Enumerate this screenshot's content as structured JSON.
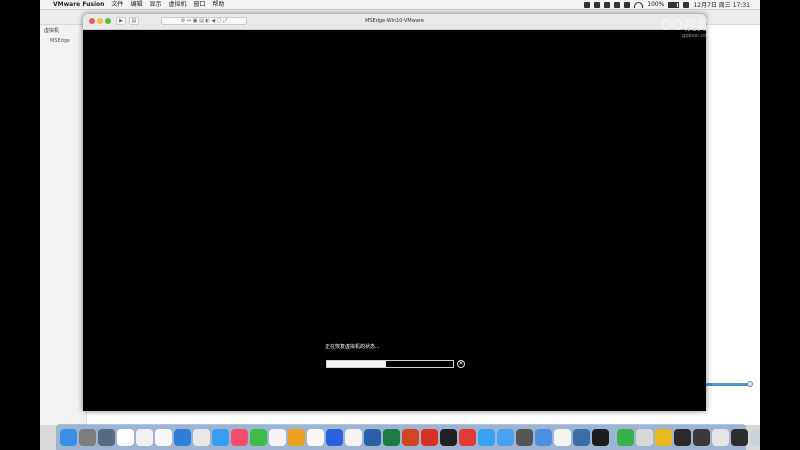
{
  "menubar": {
    "app_name": "VMware Fusion",
    "menus": [
      "文件",
      "编辑",
      "显示",
      "虚拟机",
      "窗口",
      "帮助"
    ],
    "battery_percent": "100%",
    "clock": "12月7日 周三 17:31"
  },
  "library": {
    "sidebar_header": "虚拟机",
    "sidebar_item": "MSEdge"
  },
  "vm_window": {
    "title": "MSEdge-Win10-VMware",
    "restore_message": "正在恢复虚拟机的状态...",
    "progress": 0.47,
    "cancel_symbol": "✕"
  },
  "dock": {
    "icons": [
      {
        "name": "finder-icon",
        "color": "#3d8ee6"
      },
      {
        "name": "system-preferences-icon",
        "color": "#7d7d7d"
      },
      {
        "name": "launchpad-icon",
        "color": "#5a6b80"
      },
      {
        "name": "calendar-icon",
        "color": "#ffffff"
      },
      {
        "name": "notes-icon",
        "color": "#f0f0f0"
      },
      {
        "name": "reminders-icon",
        "color": "#f7f7f7"
      },
      {
        "name": "safari-icon",
        "color": "#2f7fd8"
      },
      {
        "name": "chrome-icon",
        "color": "#e8e8e8"
      },
      {
        "name": "appstore-icon",
        "color": "#3a9cf0"
      },
      {
        "name": "music-icon",
        "color": "#f24e6b"
      },
      {
        "name": "wechat-icon",
        "color": "#3fbb4a"
      },
      {
        "name": "photos-icon",
        "color": "#f4f4f4"
      },
      {
        "name": "pages-icon",
        "color": "#f0a020"
      },
      {
        "name": "vpn-icon",
        "color": "#f8f8f8"
      },
      {
        "name": "baidu-icon",
        "color": "#2860e0"
      },
      {
        "name": "cloud-icon",
        "color": "#f3f3f3"
      },
      {
        "name": "word-icon",
        "color": "#2b5faa"
      },
      {
        "name": "excel-icon",
        "color": "#1f7a45"
      },
      {
        "name": "powerpoint-icon",
        "color": "#d04625"
      },
      {
        "name": "wps-icon",
        "color": "#d93025"
      },
      {
        "name": "unity-icon",
        "color": "#222222"
      },
      {
        "name": "chrome2-icon",
        "color": "#e53935"
      },
      {
        "name": "qq-icon",
        "color": "#38a2f0"
      },
      {
        "name": "compass-icon",
        "color": "#4aa0f0"
      },
      {
        "name": "remote-icon",
        "color": "#555555"
      },
      {
        "name": "textedit-icon",
        "color": "#4a8fe0"
      },
      {
        "name": "script-icon",
        "color": "#f4f4f4"
      },
      {
        "name": "vmware-icon",
        "color": "#3b6ea8"
      },
      {
        "name": "terminal-icon",
        "color": "#1e1e1e"
      }
    ],
    "right_icons": [
      {
        "name": "facetime-icon",
        "color": "#35b34a"
      },
      {
        "name": "folder-icon",
        "color": "#d8d8d8"
      },
      {
        "name": "keynote-icon",
        "color": "#e8b820"
      },
      {
        "name": "obs-icon",
        "color": "#2a2a2a"
      },
      {
        "name": "screenshot-icon",
        "color": "#3a3a3a"
      },
      {
        "name": "preview-icon",
        "color": "#e6e6e6"
      },
      {
        "name": "display-icon",
        "color": "#2d2d2d"
      },
      {
        "name": "trash-icon",
        "color": "#c9d3dc"
      }
    ]
  },
  "watermark": {
    "text": "OO视频",
    "subtext": "gpbosi.com"
  }
}
